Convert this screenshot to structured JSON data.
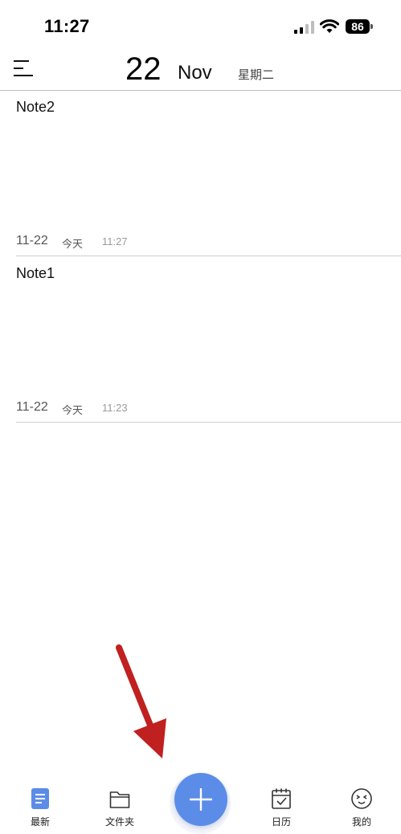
{
  "status_bar": {
    "time": "11:27",
    "battery": "86",
    "icons": [
      "signal-icon",
      "wifi-icon",
      "battery-icon"
    ]
  },
  "header": {
    "menu_icon": "menu-icon",
    "day": "22",
    "month": "Nov",
    "weekday": "星期二"
  },
  "notes": [
    {
      "title": "Note2",
      "date": "11-22",
      "day_label": "今天",
      "time": "11:27"
    },
    {
      "title": "Note1",
      "date": "11-22",
      "day_label": "今天",
      "time": "11:23"
    }
  ],
  "bottom_nav": {
    "items": [
      {
        "label": "最新",
        "icon": "document-icon",
        "active": true
      },
      {
        "label": "文件夹",
        "icon": "folder-icon",
        "active": false
      },
      {
        "label": "日历",
        "icon": "calendar-icon",
        "active": false
      },
      {
        "label": "我的",
        "icon": "face-icon",
        "active": false
      }
    ],
    "fab_icon": "plus-icon"
  },
  "colors": {
    "accent": "#5b8ce8",
    "active_icon": "#5b8ce8",
    "annotation_arrow": "#c0201f"
  }
}
